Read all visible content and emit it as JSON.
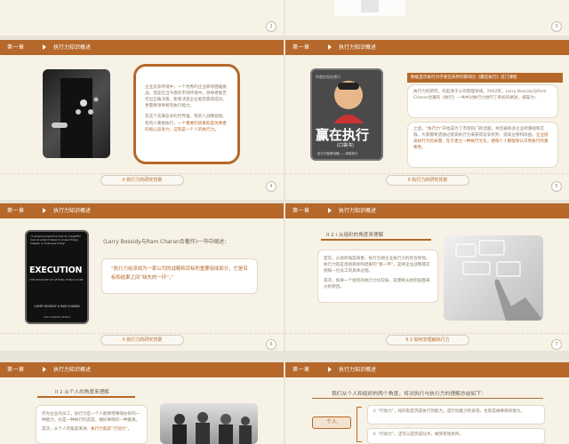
{
  "common": {
    "chapter": "第一章",
    "title": "执行力知识概述"
  },
  "slide1": {
    "page": "2"
  },
  "slide2": {
    "page": "3"
  },
  "slide3": {
    "p1": "企业竞争环境中，一个优秀的企业即将面临挑战。但是在当今激烈市场环境中，领导者能否作出正确决策，能够决定企业能否获得成功，更需要领导者的执行能力。",
    "p2": "在这个充满竞争的世界里，有的人战略规划，有的人重视执行，",
    "p2b": "一个重要的因素就是优秀者的核心竞争力，这就是一个人的执行力。",
    "footer": "II 执行力的研究背景",
    "page": "4"
  },
  "slide4": {
    "book_title": "赢在执行",
    "book_sub": "(口袋书)",
    "book_top": "你就在现在就行",
    "book_desc": "执行力就是战略——卓越执行",
    "banner": "数据显示执行力学者在商界的影响力《赢在执行》这门课程",
    "p1": "执行力的研究，先起源于公司管理领域。2002年，Larry Bossidy与Ram Charan合著的《执行》一书中对执行力进行了系统的阐述，被誉为：",
    "p2a": "之后，",
    "p2b": "“执行力”",
    "p2c": "开始成为了市场热门的话题。并且被很多企业所重视和实践。大家都希望通过提高执行力来获得竞争优势，提高业绩和效益。",
    "p2d": "企业提高执行力的关键，在于建立一种执行文化，使每个人都能够认识到执行的重要性。",
    "footer": "II 执行力的研究背景",
    "page": "5"
  },
  "slide5": {
    "book_quote": "\"A great perspective and an insightful look at what it takes to make things happen in business today\"",
    "book_title": "EXECUTION",
    "book_sub": "THE DISCIPLINE OF GETTING THINGS DONE",
    "authors": "LARRY BOSSIDY & RAM CHARAN",
    "with": "with CHARLES BURCK",
    "intro": "(Larry Bossidy与Ram Charan合著作)一书中阐述：",
    "quote_a": "“执行力给该成为一家公司的战略和目标的重要组成部分，它是目标和结果之间“缺失的一环”。”",
    "footer": "II 执行力的研究背景",
    "page": "6"
  },
  "slide6": {
    "heading": "II 2 I 从组织的角度来理解",
    "p1": "首先，从组织角度来看，执行力即企业执行力的综合体现。执行力就是连接目标和结果的",
    "p1h": "“第一环”",
    "p1b": "，是将企业战略落实到每一位员工的具体过程。",
    "p2": "其次，如果一个组织的执行力比较弱，就需要从组织层面来分析原因。",
    "footer": "II 2 如何去理解执行力",
    "page": "7"
  },
  "slide7": {
    "heading": "II 2 从个人的角度来理解",
    "p1": "作为企业的员工，执行力是一个人能够把事情办好的一种能力，也是一种执行的态度，做好事情的一种素质。",
    "p2a": "其次，从个人的角度来讲，",
    "p2b": "执行力就是“行动力”。"
  },
  "slide8": {
    "intro": "我们从个人和组织的两个角度，将对执行与执行力的理解总结如下：",
    "tag": "个人",
    "i1": "① “行动力”，指的就是完成执行的能力，是行动能力的表现，也就是做事情的能力。",
    "i2": "② “行动力”，还可以是完成任务，做到有始有终。"
  }
}
